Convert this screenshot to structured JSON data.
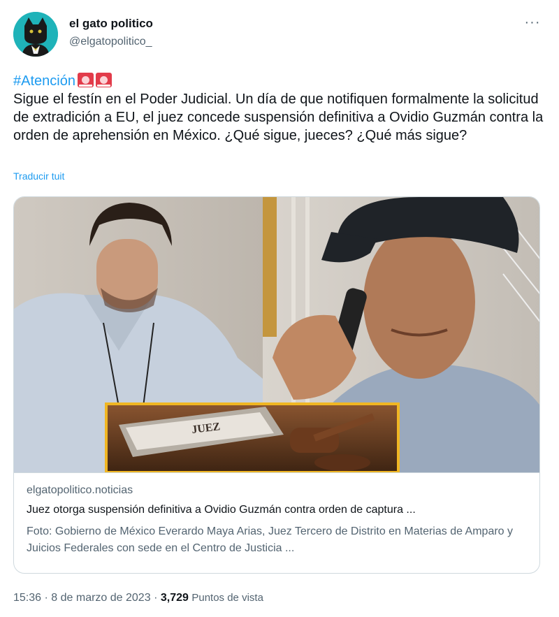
{
  "author": {
    "name": "el gato politico",
    "handle": "@elgatopolitico_"
  },
  "tweet": {
    "hashtag": "#Atención",
    "emoji": [
      "police-siren",
      "police-siren"
    ],
    "text": "Sigue el festín en el Poder Judicial. Un día de que notifiquen formalmente la solicitud de extradición a EU, el juez concede suspensión definitiva a Ovidio Guzmán contra la orden de aprehensión en México. ¿Qué sigue, jueces? ¿Qué más sigue?",
    "translate_label": "Traducir tuit"
  },
  "card": {
    "image_text": "JUEZ",
    "domain": "elgatopolitico.noticias",
    "title": "Juez otorga suspensión definitiva a Ovidio Guzmán contra orden de captura ...",
    "description": "Foto: Gobierno de México Everardo Maya Arias, Juez Tercero de Distrito en Materias de Amparo y Juicios Federales con sede en el Centro de Justicia ..."
  },
  "meta": {
    "time": "15:36",
    "separator": "·",
    "date": "8 de marzo de 2023",
    "views_count": "3,729",
    "views_label": "Puntos de vista"
  },
  "colors": {
    "accent": "#1d9bf0",
    "avatar_bg": "#1fb3b9",
    "secondary_text": "#536471"
  }
}
